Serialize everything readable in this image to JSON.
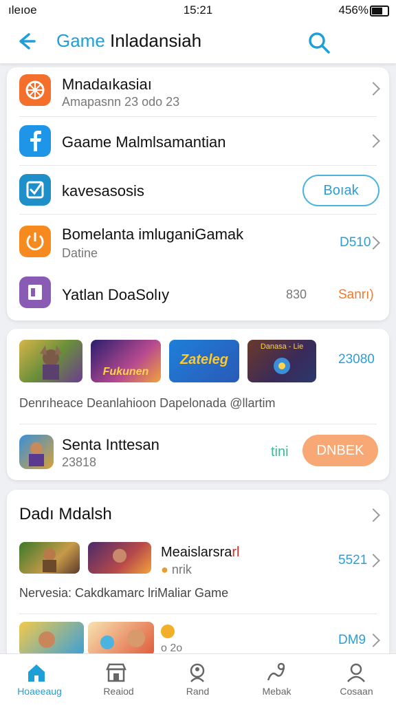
{
  "status": {
    "carrier": "ıleıoe",
    "time": "15:21",
    "battery": "456%"
  },
  "header": {
    "title_accent": "Game",
    "title_rest": "Inladansiah"
  },
  "list": [
    {
      "title": "Mnadaıkasiaı",
      "subtitle": "Amapasnn 23 odo 23",
      "icon": "orange-spin-icon"
    },
    {
      "title": "Gaame Malmlsamantian",
      "icon": "facebook-f-icon"
    },
    {
      "title": "kavesasosis",
      "button": "Boıak",
      "icon": "check-square-icon"
    },
    {
      "title": "Bomelanta imluganiGamak",
      "subtitle": "Datine",
      "value": "D510",
      "icon": "power-icon"
    },
    {
      "title": "Yatlan DoaSolıy",
      "value": "830",
      "action": "Sanrı)",
      "icon": "purple-doc-icon"
    }
  ],
  "games": {
    "count": "23080",
    "thumb_texts": [
      "",
      "Fukunen",
      "Zateleg",
      "Danasa - Lie"
    ],
    "caption": "Denrıheace  Deanlahioon  Dapelonada  @llartim",
    "featured": {
      "title": "Senta Inttesan",
      "subtitle": "23818",
      "tag": "tini",
      "button": "DNBEK"
    }
  },
  "section": {
    "title": "Dadı Mdalsh",
    "item1": {
      "title_black": "Meaislarsra",
      "title_red": "rl",
      "subtitle": "nrik",
      "value": "5521"
    },
    "caption": "Nervesia:  Cakdkamarc  lriMaliar Game",
    "item2": {
      "value": "DM9",
      "sub": "o 2o"
    }
  },
  "tabs": [
    {
      "label": "Hoaeeaug",
      "icon": "home-icon"
    },
    {
      "label": "Reaiod",
      "icon": "store-icon"
    },
    {
      "label": "Rand",
      "icon": "person-pin-icon"
    },
    {
      "label": "Mebak",
      "icon": "wave-icon"
    },
    {
      "label": "Cosaan",
      "icon": "profile-icon"
    }
  ],
  "colors": {
    "accent": "#1e9fd8",
    "orange": "#f58a2a",
    "purple": "#8a5bb5"
  }
}
